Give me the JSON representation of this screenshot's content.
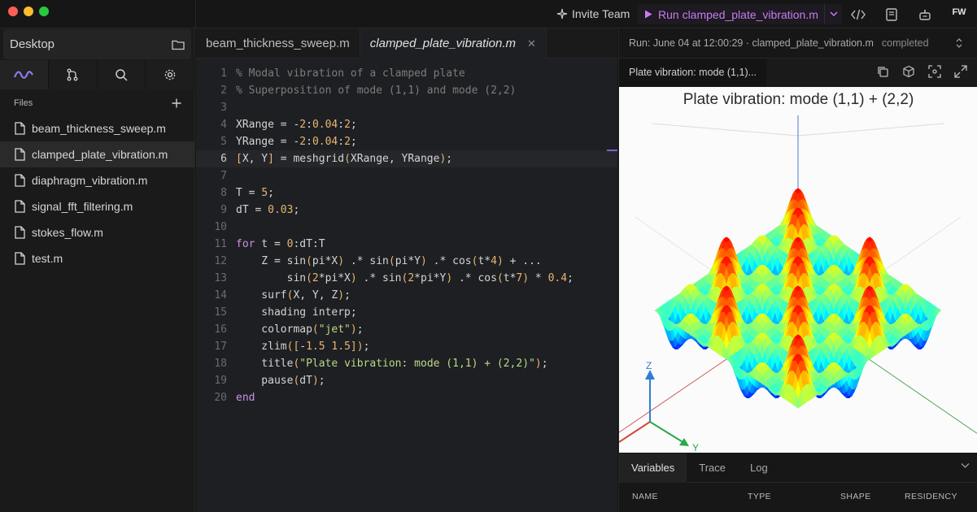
{
  "topbar": {
    "invite_label": "Invite Team",
    "run_label": "Run clamped_plate_vibration.m",
    "user_initials": "FW"
  },
  "sidebar": {
    "workspace": "Desktop",
    "section_label": "Files",
    "files": [
      {
        "name": "beam_thickness_sweep.m",
        "active": false
      },
      {
        "name": "clamped_plate_vibration.m",
        "active": true
      },
      {
        "name": "diaphragm_vibration.m",
        "active": false
      },
      {
        "name": "signal_fft_filtering.m",
        "active": false
      },
      {
        "name": "stokes_flow.m",
        "active": false
      },
      {
        "name": "test.m",
        "active": false
      }
    ]
  },
  "editor": {
    "tabs": [
      {
        "label": "beam_thickness_sweep.m",
        "active": false
      },
      {
        "label": "clamped_plate_vibration.m",
        "active": true
      }
    ],
    "current_line": 6,
    "lines": [
      "% Modal vibration of a clamped plate",
      "% Superposition of mode (1,1) and mode (2,2)",
      "",
      "XRange = -2:0.04:2;",
      "YRange = -2:0.04:2;",
      "[X, Y] = meshgrid(XRange, YRange);",
      "",
      "T = 5;",
      "dT = 0.03;",
      "",
      "for t = 0:dT:T",
      "    Z = sin(pi*X) .* sin(pi*Y) .* cos(t*4) + ...",
      "        sin(2*pi*X) .* sin(2*pi*Y) .* cos(t*7) * 0.4;",
      "    surf(X, Y, Z);",
      "    shading interp;",
      "    colormap(\"jet\");",
      "    zlim([-1.5 1.5]);",
      "    title(\"Plate vibration: mode (1,1) + (2,2)\");",
      "    pause(dT);",
      "end"
    ]
  },
  "run": {
    "info": "Run: June 04 at 12:00:29 · clamped_plate_vibration.m",
    "status": "completed"
  },
  "figure": {
    "tab_label": "Plate vibration: mode (1,1)...",
    "title": "Plate vibration: mode (1,1) + (2,2)",
    "axis_z": "Z",
    "axis_y": "Y"
  },
  "bottom_panel": {
    "tabs": [
      "Variables",
      "Trace",
      "Log"
    ],
    "active_tab": "Variables",
    "columns": [
      "NAME",
      "TYPE",
      "SHAPE",
      "RESIDENCY"
    ]
  }
}
